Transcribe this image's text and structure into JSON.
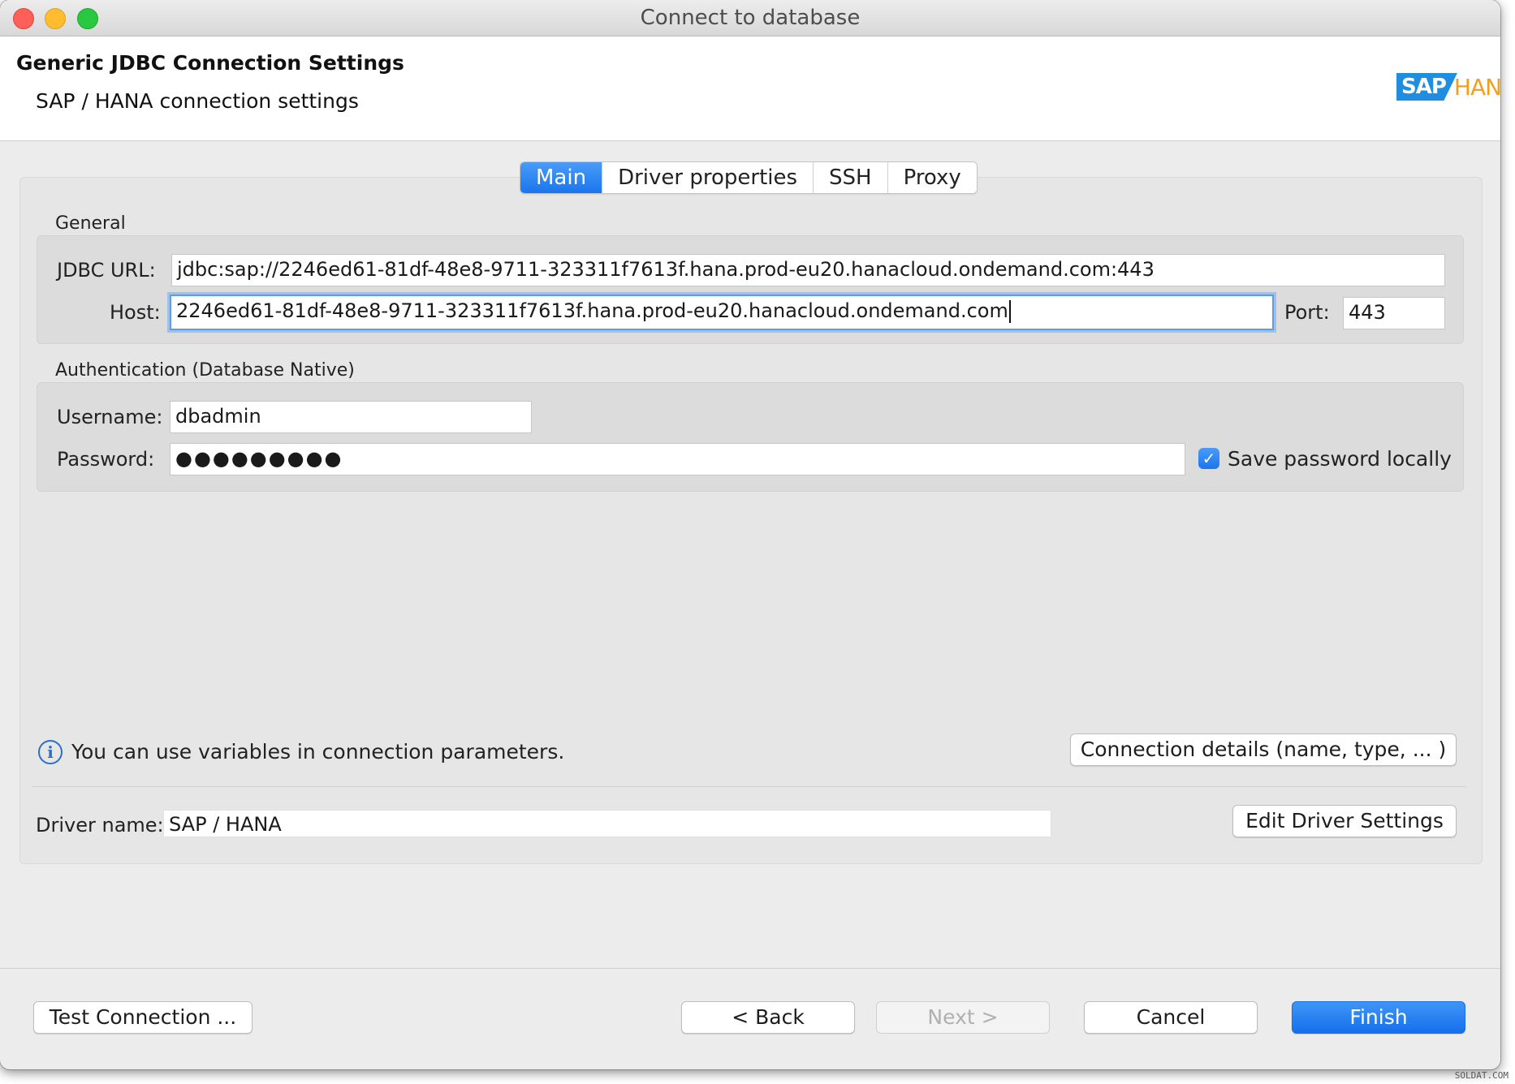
{
  "window": {
    "title": "Connect to database"
  },
  "header": {
    "title": "Generic JDBC Connection Settings",
    "subtitle": "SAP / HANA connection settings",
    "logo_sap": "SAP",
    "logo_hana": "HANA"
  },
  "tabs": [
    {
      "label": "Main",
      "active": true
    },
    {
      "label": "Driver properties",
      "active": false
    },
    {
      "label": "SSH",
      "active": false
    },
    {
      "label": "Proxy",
      "active": false
    }
  ],
  "general": {
    "section_label": "General",
    "jdbc_url_label": "JDBC URL:",
    "jdbc_url_value": "jdbc:sap://2246ed61-81df-48e8-9711-323311f7613f.hana.prod-eu20.hanacloud.ondemand.com:443",
    "host_label": "Host:",
    "host_value": "2246ed61-81df-48e8-9711-323311f7613f.hana.prod-eu20.hanacloud.ondemand.com",
    "port_label": "Port:",
    "port_value": "443"
  },
  "auth": {
    "section_label": "Authentication (Database Native)",
    "username_label": "Username:",
    "username_value": "dbadmin",
    "password_label": "Password:",
    "password_value": "●●●●●●●●●",
    "save_password_label": "Save password locally",
    "save_password_checked": true
  },
  "info": {
    "message": "You can use variables in connection parameters.",
    "connection_details_label": "Connection details (name, type, ... )"
  },
  "driver": {
    "name_label": "Driver name:",
    "name_value": "SAP / HANA",
    "edit_label": "Edit Driver Settings"
  },
  "footer": {
    "test_label": "Test Connection ...",
    "back_label": "< Back",
    "next_label": "Next >",
    "cancel_label": "Cancel",
    "finish_label": "Finish"
  },
  "watermark": "SOLDAT.COM",
  "colors": {
    "accent": "#1a76ee",
    "logo_blue": "#1f8ee0",
    "logo_orange": "#f0a01e"
  }
}
